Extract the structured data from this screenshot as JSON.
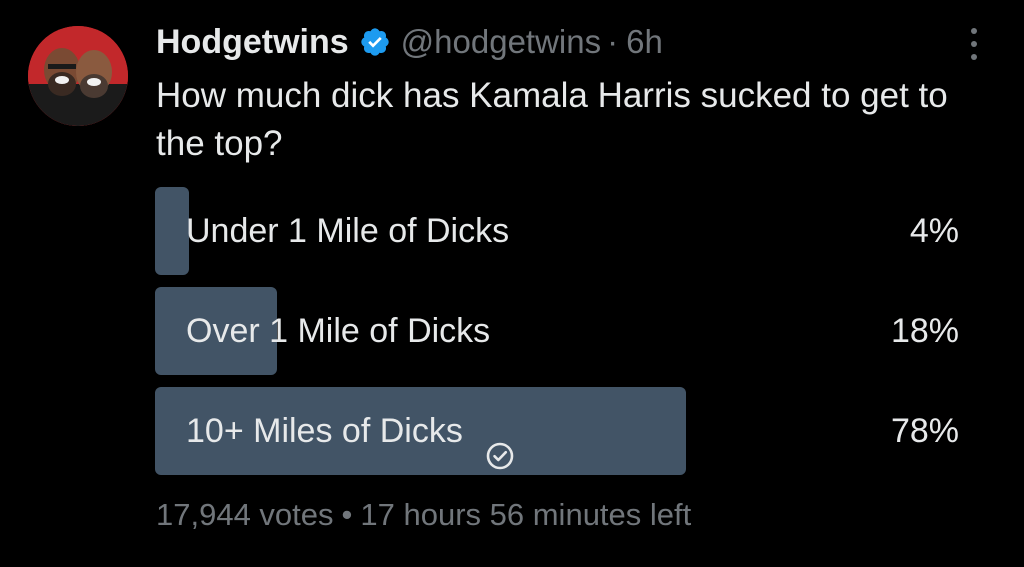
{
  "tweet": {
    "display_name": "Hodgetwins",
    "handle": "@hodgetwins",
    "separator": "·",
    "time": "6h",
    "text": "How much dick has Kamala Harris sucked to get to the top?"
  },
  "poll": {
    "options": [
      {
        "label": "Under 1 Mile of Dicks",
        "percent_text": "4%",
        "percent": 4,
        "selected": false
      },
      {
        "label": "Over 1 Mile of Dicks",
        "percent_text": "18%",
        "percent": 18,
        "selected": false
      },
      {
        "label": "10+ Miles of Dicks",
        "percent_text": "78%",
        "percent": 78,
        "selected": true
      }
    ],
    "votes": "17,944 votes",
    "separator": "•",
    "time_left": "17 hours 56 minutes left"
  },
  "icons": {
    "verified": "verified-badge-icon",
    "more": "more-options-icon",
    "selected_check": "check-circle-icon"
  },
  "colors": {
    "background": "#000000",
    "text": "#e7e9ea",
    "muted": "#71767b",
    "bar": "#425466",
    "verified": "#1d9bf0"
  }
}
